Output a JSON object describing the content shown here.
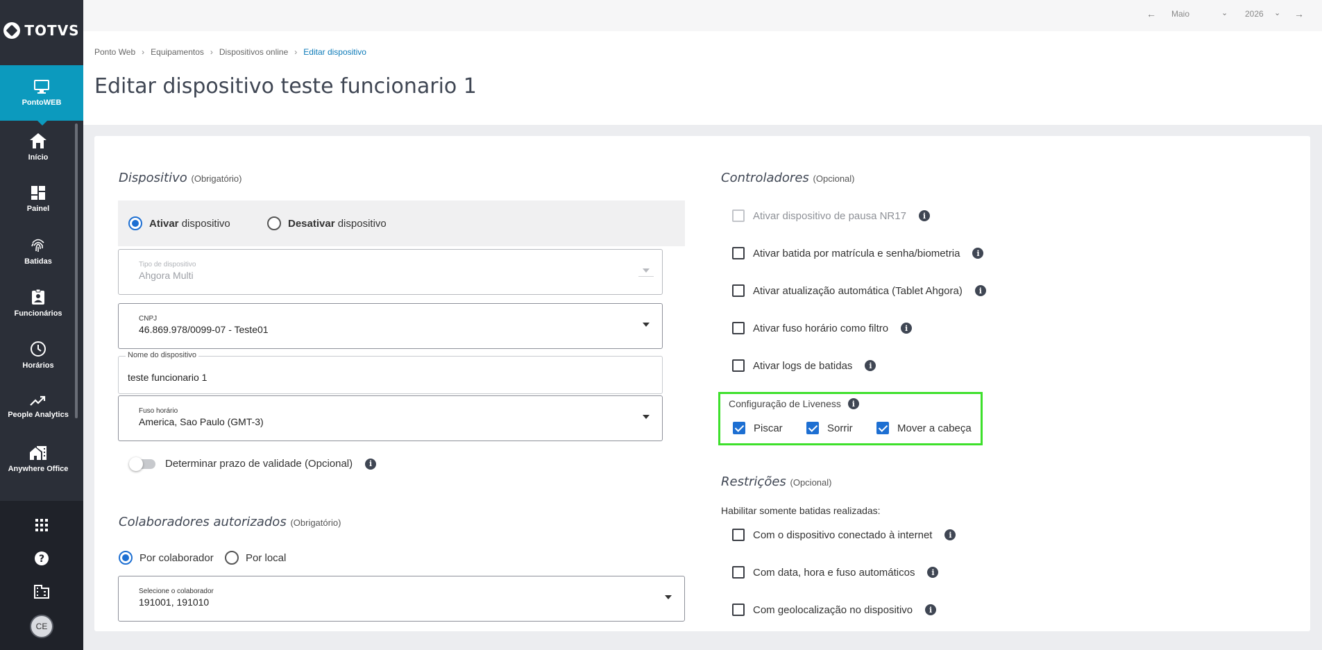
{
  "brand": {
    "name": "TOTVS"
  },
  "sidebar": {
    "active": {
      "label": "PontoWEB",
      "icon": "monitor-icon"
    },
    "items": [
      {
        "label": "Início",
        "icon": "home-icon"
      },
      {
        "label": "Painel",
        "icon": "dashboard-icon"
      },
      {
        "label": "Batidas",
        "icon": "fingerprint-icon"
      },
      {
        "label": "Funcionários",
        "icon": "badge-icon"
      },
      {
        "label": "Horários",
        "icon": "clock-icon"
      },
      {
        "label": "People Analytics",
        "icon": "trending-icon"
      },
      {
        "label": "Anywhere Office",
        "icon": "home-work-icon"
      }
    ],
    "bottom": [
      "apps-grid-icon",
      "help-icon",
      "company-icon"
    ],
    "avatar_initials": "CE"
  },
  "topbar": {
    "month": "Maio",
    "year": "2026"
  },
  "breadcrumb": [
    "Ponto Web",
    "Equipamentos",
    "Dispositivos online",
    "Editar dispositivo"
  ],
  "page_title": "Editar dispositivo teste funcionario 1",
  "dispositivo": {
    "title": "Dispositivo",
    "optional": "(Obrigatório)",
    "activate_bold": "Ativar",
    "activate_rest": "dispositivo",
    "deactivate_bold": "Desativar",
    "deactivate_rest": "dispositivo",
    "tipo_label": "Tipo de dispositivo",
    "tipo_value": "Ahgora Multi",
    "cnpj_label": "CNPJ",
    "cnpj_value": "46.869.978/0099-07 - Teste01",
    "nome_label": "Nome do dispositivo",
    "nome_value": "teste funcionario 1",
    "fuso_label": "Fuso horário",
    "fuso_value": "America, Sao Paulo (GMT-3)",
    "validade_label": "Determinar prazo de validade (Opcional)"
  },
  "colaboradores": {
    "title": "Colaboradores autorizados",
    "optional": "(Obrigatório)",
    "por_colaborador": "Por colaborador",
    "por_local": "Por local",
    "select_label": "Selecione o colaborador",
    "select_value": "191001, 191010"
  },
  "controladores": {
    "title": "Controladores",
    "optional": "(Opcional)",
    "items": [
      {
        "label": "Ativar dispositivo de pausa NR17",
        "checked": false,
        "disabled": true
      },
      {
        "label": "Ativar batida por matrícula e senha/biometria",
        "checked": false,
        "disabled": false
      },
      {
        "label": "Ativar atualização automática (Tablet Ahgora)",
        "checked": false,
        "disabled": false
      },
      {
        "label": "Ativar fuso horário como filtro",
        "checked": false,
        "disabled": false
      },
      {
        "label": "Ativar logs de batidas",
        "checked": false,
        "disabled": false
      }
    ],
    "liveness": {
      "title": "Configuração de Liveness",
      "options": [
        {
          "label": "Piscar",
          "checked": true
        },
        {
          "label": "Sorrir",
          "checked": true
        },
        {
          "label": "Mover a cabeça",
          "checked": true
        }
      ]
    }
  },
  "restricoes": {
    "title": "Restrições",
    "optional": "(Opcional)",
    "subtitle": "Habilitar somente batidas realizadas:",
    "items": [
      {
        "label": "Com o dispositivo conectado à internet",
        "checked": false
      },
      {
        "label": "Com data, hora e fuso automáticos",
        "checked": false
      },
      {
        "label": "Com geolocalização no dispositivo",
        "checked": false
      }
    ]
  },
  "colors": {
    "accent": "#0c9abe",
    "primary": "#1d6fd2",
    "highlight": "#3de02b",
    "sidebar": "#2b2f38"
  }
}
